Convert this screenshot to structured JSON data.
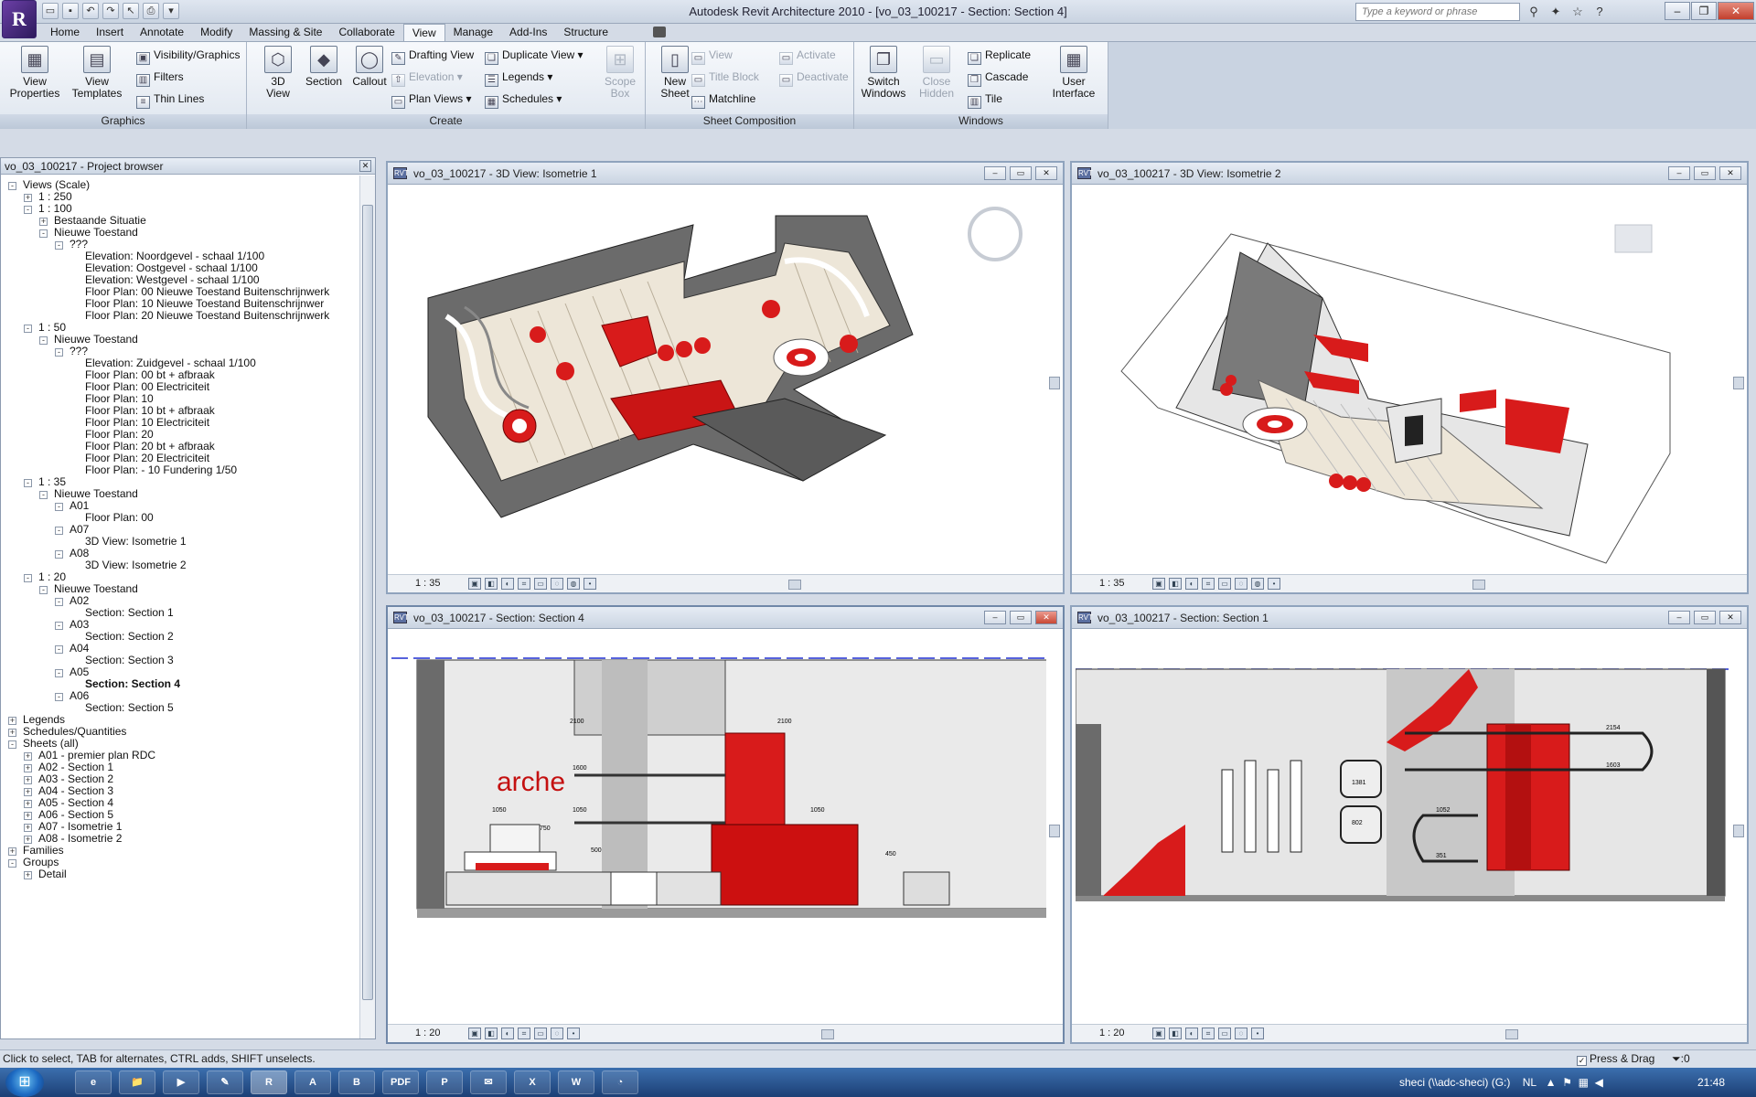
{
  "app": {
    "logo": "R",
    "title": "Autodesk Revit Architecture 2010 - [vo_03_100217 - Section: Section 4]",
    "search_placeholder": "Type a keyword or phrase"
  },
  "ribbon_tabs": [
    "Home",
    "Insert",
    "Annotate",
    "Modify",
    "Massing & Site",
    "Collaborate",
    "View",
    "Manage",
    "Add-Ins",
    "Structure"
  ],
  "ribbon": {
    "graphics": {
      "label": "Graphics",
      "view_properties": "View\nProperties",
      "view_templates": "View\nTemplates",
      "visibility": "Visibility/Graphics",
      "filters": "Filters",
      "thin_lines": "Thin Lines"
    },
    "create": {
      "label": "Create",
      "view3d": "3D\nView",
      "section": "Section",
      "callout": "Callout",
      "drafting_view": "Drafting View",
      "elevation": "Elevation",
      "plan_views": "Plan Views",
      "duplicate_view": "Duplicate View",
      "legends": "Legends",
      "schedules": "Schedules",
      "scope_box": "Scope\nBox"
    },
    "sheet": {
      "label": "Sheet Composition",
      "new_sheet": "New\nSheet",
      "view": "View",
      "title_block": "Title Block",
      "matchline": "Matchline",
      "activate": "Activate",
      "deactivate": "Deactivate"
    },
    "windows": {
      "label": "Windows",
      "switch_windows": "Switch\nWindows",
      "close_hidden": "Close\nHidden",
      "replicate": "Replicate",
      "cascade": "Cascade",
      "tile": "Tile",
      "user_interface": "User\nInterface"
    }
  },
  "browser": {
    "title": "vo_03_100217 - Project browser",
    "items": [
      {
        "label": "Views (Scale)",
        "lvl": 0,
        "tg": "-"
      },
      {
        "label": "1 : 250",
        "lvl": 1,
        "tg": "+"
      },
      {
        "label": "1 : 100",
        "lvl": 1,
        "tg": "-"
      },
      {
        "label": "Bestaande Situatie",
        "lvl": 2,
        "tg": "+"
      },
      {
        "label": "Nieuwe Toestand",
        "lvl": 2,
        "tg": "-"
      },
      {
        "label": "???",
        "lvl": 3,
        "tg": "-"
      },
      {
        "label": "Elevation: Noordgevel - schaal 1/100",
        "lvl": 4,
        "tg": ""
      },
      {
        "label": "Elevation: Oostgevel - schaal 1/100",
        "lvl": 4,
        "tg": ""
      },
      {
        "label": "Elevation: Westgevel - schaal 1/100",
        "lvl": 4,
        "tg": ""
      },
      {
        "label": "Floor Plan: 00 Nieuwe Toestand Buitenschrijnwerk",
        "lvl": 4,
        "tg": ""
      },
      {
        "label": "Floor Plan: 10 Nieuwe Toestand Buitenschrijnwer",
        "lvl": 4,
        "tg": ""
      },
      {
        "label": "Floor Plan: 20 Nieuwe Toestand Buitenschrijnwerk",
        "lvl": 4,
        "tg": ""
      },
      {
        "label": "1 : 50",
        "lvl": 1,
        "tg": "-"
      },
      {
        "label": "Nieuwe Toestand",
        "lvl": 2,
        "tg": "-"
      },
      {
        "label": "???",
        "lvl": 3,
        "tg": "-"
      },
      {
        "label": "Elevation: Zuidgevel - schaal 1/100",
        "lvl": 4,
        "tg": ""
      },
      {
        "label": "Floor Plan: 00 bt + afbraak",
        "lvl": 4,
        "tg": ""
      },
      {
        "label": "Floor Plan: 00 Electriciteit",
        "lvl": 4,
        "tg": ""
      },
      {
        "label": "Floor Plan: 10",
        "lvl": 4,
        "tg": ""
      },
      {
        "label": "Floor Plan: 10 bt + afbraak",
        "lvl": 4,
        "tg": ""
      },
      {
        "label": "Floor Plan: 10 Electriciteit",
        "lvl": 4,
        "tg": ""
      },
      {
        "label": "Floor Plan: 20",
        "lvl": 4,
        "tg": ""
      },
      {
        "label": "Floor Plan: 20 bt + afbraak",
        "lvl": 4,
        "tg": ""
      },
      {
        "label": "Floor Plan: 20 Electriciteit",
        "lvl": 4,
        "tg": ""
      },
      {
        "label": "Floor Plan: - 10 Fundering 1/50",
        "lvl": 4,
        "tg": ""
      },
      {
        "label": "1 : 35",
        "lvl": 1,
        "tg": "-"
      },
      {
        "label": "Nieuwe Toestand",
        "lvl": 2,
        "tg": "-"
      },
      {
        "label": "A01",
        "lvl": 3,
        "tg": "-"
      },
      {
        "label": "Floor Plan: 00",
        "lvl": 4,
        "tg": ""
      },
      {
        "label": "A07",
        "lvl": 3,
        "tg": "-"
      },
      {
        "label": "3D View: Isometrie 1",
        "lvl": 4,
        "tg": ""
      },
      {
        "label": "A08",
        "lvl": 3,
        "tg": "-"
      },
      {
        "label": "3D View: Isometrie 2",
        "lvl": 4,
        "tg": ""
      },
      {
        "label": "1 : 20",
        "lvl": 1,
        "tg": "-"
      },
      {
        "label": "Nieuwe Toestand",
        "lvl": 2,
        "tg": "-"
      },
      {
        "label": "A02",
        "lvl": 3,
        "tg": "-"
      },
      {
        "label": "Section: Section 1",
        "lvl": 4,
        "tg": ""
      },
      {
        "label": "A03",
        "lvl": 3,
        "tg": "-"
      },
      {
        "label": "Section: Section 2",
        "lvl": 4,
        "tg": ""
      },
      {
        "label": "A04",
        "lvl": 3,
        "tg": "-"
      },
      {
        "label": "Section: Section 3",
        "lvl": 4,
        "tg": ""
      },
      {
        "label": "A05",
        "lvl": 3,
        "tg": "-"
      },
      {
        "label": "Section: Section 4",
        "lvl": 4,
        "tg": "",
        "sel": true
      },
      {
        "label": "A06",
        "lvl": 3,
        "tg": "-"
      },
      {
        "label": "Section: Section 5",
        "lvl": 4,
        "tg": ""
      },
      {
        "label": "Legends",
        "lvl": 0,
        "tg": "+"
      },
      {
        "label": "Schedules/Quantities",
        "lvl": 0,
        "tg": "+"
      },
      {
        "label": "Sheets (all)",
        "lvl": 0,
        "tg": "-"
      },
      {
        "label": "A01 - premier plan RDC",
        "lvl": 1,
        "tg": "+"
      },
      {
        "label": "A02 - Section 1",
        "lvl": 1,
        "tg": "+"
      },
      {
        "label": "A03 - Section 2",
        "lvl": 1,
        "tg": "+"
      },
      {
        "label": "A04 - Section 3",
        "lvl": 1,
        "tg": "+"
      },
      {
        "label": "A05 - Section 4",
        "lvl": 1,
        "tg": "+"
      },
      {
        "label": "A06 - Section 5",
        "lvl": 1,
        "tg": "+"
      },
      {
        "label": "A07 - Isometrie 1",
        "lvl": 1,
        "tg": "+"
      },
      {
        "label": "A08 - Isometrie 2",
        "lvl": 1,
        "tg": "+"
      },
      {
        "label": "Families",
        "lvl": 0,
        "tg": "+"
      },
      {
        "label": "Groups",
        "lvl": 0,
        "tg": "-"
      },
      {
        "label": "Detail",
        "lvl": 1,
        "tg": "+"
      }
    ]
  },
  "views": {
    "v1": {
      "title": "vo_03_100217 - 3D View: Isometrie 1",
      "scale": "1 : 35"
    },
    "v2": {
      "title": "vo_03_100217 - 3D View: Isometrie 2",
      "scale": "1 : 35"
    },
    "v3": {
      "title": "vo_03_100217 - Section: Section 4",
      "scale": "1 : 20",
      "brand": "arche",
      "dims": [
        "2100",
        "2100",
        "1600",
        "1050",
        "1050",
        "1050",
        "750",
        "500",
        "450"
      ]
    },
    "v4": {
      "title": "vo_03_100217 - Section: Section 1",
      "scale": "1 : 20",
      "dims": [
        "2154",
        "1603",
        "1381",
        "1052",
        "802",
        "351"
      ]
    }
  },
  "status": {
    "hint": "Click to select, TAB for alternates, CTRL adds, SHIFT unselects.",
    "press_drag": "Press & Drag",
    "filter_count": ":0"
  },
  "taskbar": {
    "tray_text": "sheci (\\\\adc-sheci) (G:)",
    "lang": "NL",
    "clock": "21:48",
    "apps": [
      "e",
      "📁",
      "▶",
      "✎",
      "R",
      "A",
      "B",
      "PDF",
      "P",
      "✉",
      "X",
      "W",
      "◔"
    ]
  },
  "colors": {
    "accent_red": "#d81b1b",
    "ribbon_bg": "#dfe6ef",
    "title_bg": "#c9d3e1"
  }
}
